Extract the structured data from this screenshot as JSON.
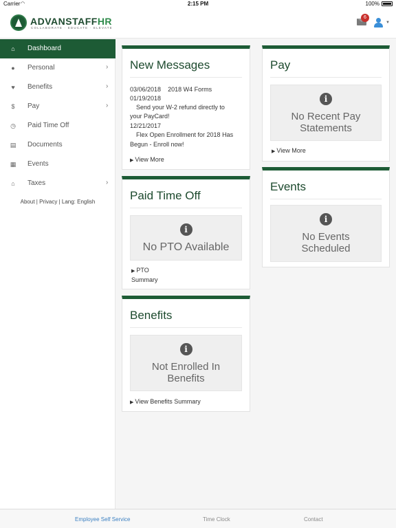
{
  "status_bar": {
    "carrier": "Carrier",
    "time": "2:15 PM",
    "battery": "100%"
  },
  "header": {
    "logo_main": "ADVANSTAFF",
    "logo_hr": "HR",
    "logo_tagline": "COLLABORATE · EDUCATE · ELEVATE",
    "mail_badge": "6"
  },
  "sidebar": {
    "items": [
      {
        "label": "Dashboard",
        "icon": "home-icon"
      },
      {
        "label": "Personal",
        "icon": "person-icon"
      },
      {
        "label": "Benefits",
        "icon": "heartbeat-icon"
      },
      {
        "label": "Pay",
        "icon": "dollar-icon"
      },
      {
        "label": "Paid Time Off",
        "icon": "clock-icon"
      },
      {
        "label": "Documents",
        "icon": "document-icon"
      },
      {
        "label": "Events",
        "icon": "calendar-icon"
      },
      {
        "label": "Taxes",
        "icon": "bank-icon"
      }
    ],
    "footer": {
      "about": "About",
      "privacy": "Privacy",
      "lang": "Lang: English"
    }
  },
  "messages": {
    "title": "New Messages",
    "items": [
      {
        "date": "03/06/2018",
        "text": "2018 W4 Forms"
      },
      {
        "date": "01/19/2018",
        "text_line1": "Send your W-2 refund directly to",
        "text_line2": "your PayCard!"
      },
      {
        "date": "12/21/2017",
        "text_line1": "Flex Open Enrollment for 2018 Has",
        "text_line2": "Begun - Enroll now!"
      }
    ],
    "view_more": "View More"
  },
  "pay": {
    "title": "Pay",
    "empty_line1": "No Recent Pay",
    "empty_line2": "Statements",
    "view_more": "View More"
  },
  "pto": {
    "title": "Paid Time Off",
    "empty": "No PTO Available",
    "link_line1": "PTO",
    "link_line2": "Summary"
  },
  "events": {
    "title": "Events",
    "empty_line1": "No Events",
    "empty_line2": "Scheduled"
  },
  "benefits": {
    "title": "Benefits",
    "empty_line1": "Not Enrolled In",
    "empty_line2": "Benefits",
    "view_summary": "View Benefits Summary"
  },
  "tabbar": {
    "tabs": [
      {
        "label": "Employee Self Service",
        "color": "#3a7fc1"
      },
      {
        "label": "Time Clock",
        "color": "#8a8a8a"
      },
      {
        "label": "Contact",
        "color": "#8a8a8a"
      }
    ]
  },
  "colors": {
    "brand": "#1d5b35",
    "badge": "#c9302c"
  }
}
